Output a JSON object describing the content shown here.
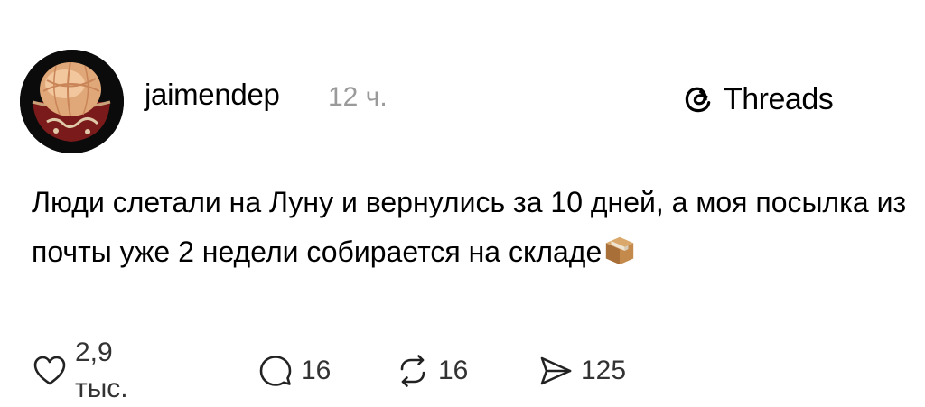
{
  "post": {
    "username": "jaimendep",
    "time_ago": "12 ч.",
    "brand": "Threads",
    "text": "Люди слетали на Луну и вернулись за 10 дней, а моя посылка из почты уже 2 недели собирается на складе",
    "emoji": "package-icon"
  },
  "actions": {
    "likes": "2,9 тыс.",
    "comments": "16",
    "reposts": "16",
    "shares": "125"
  },
  "colors": {
    "text": "#000000",
    "secondary": "#9a9a9a",
    "icon": "#333333",
    "background": "#ffffff"
  }
}
